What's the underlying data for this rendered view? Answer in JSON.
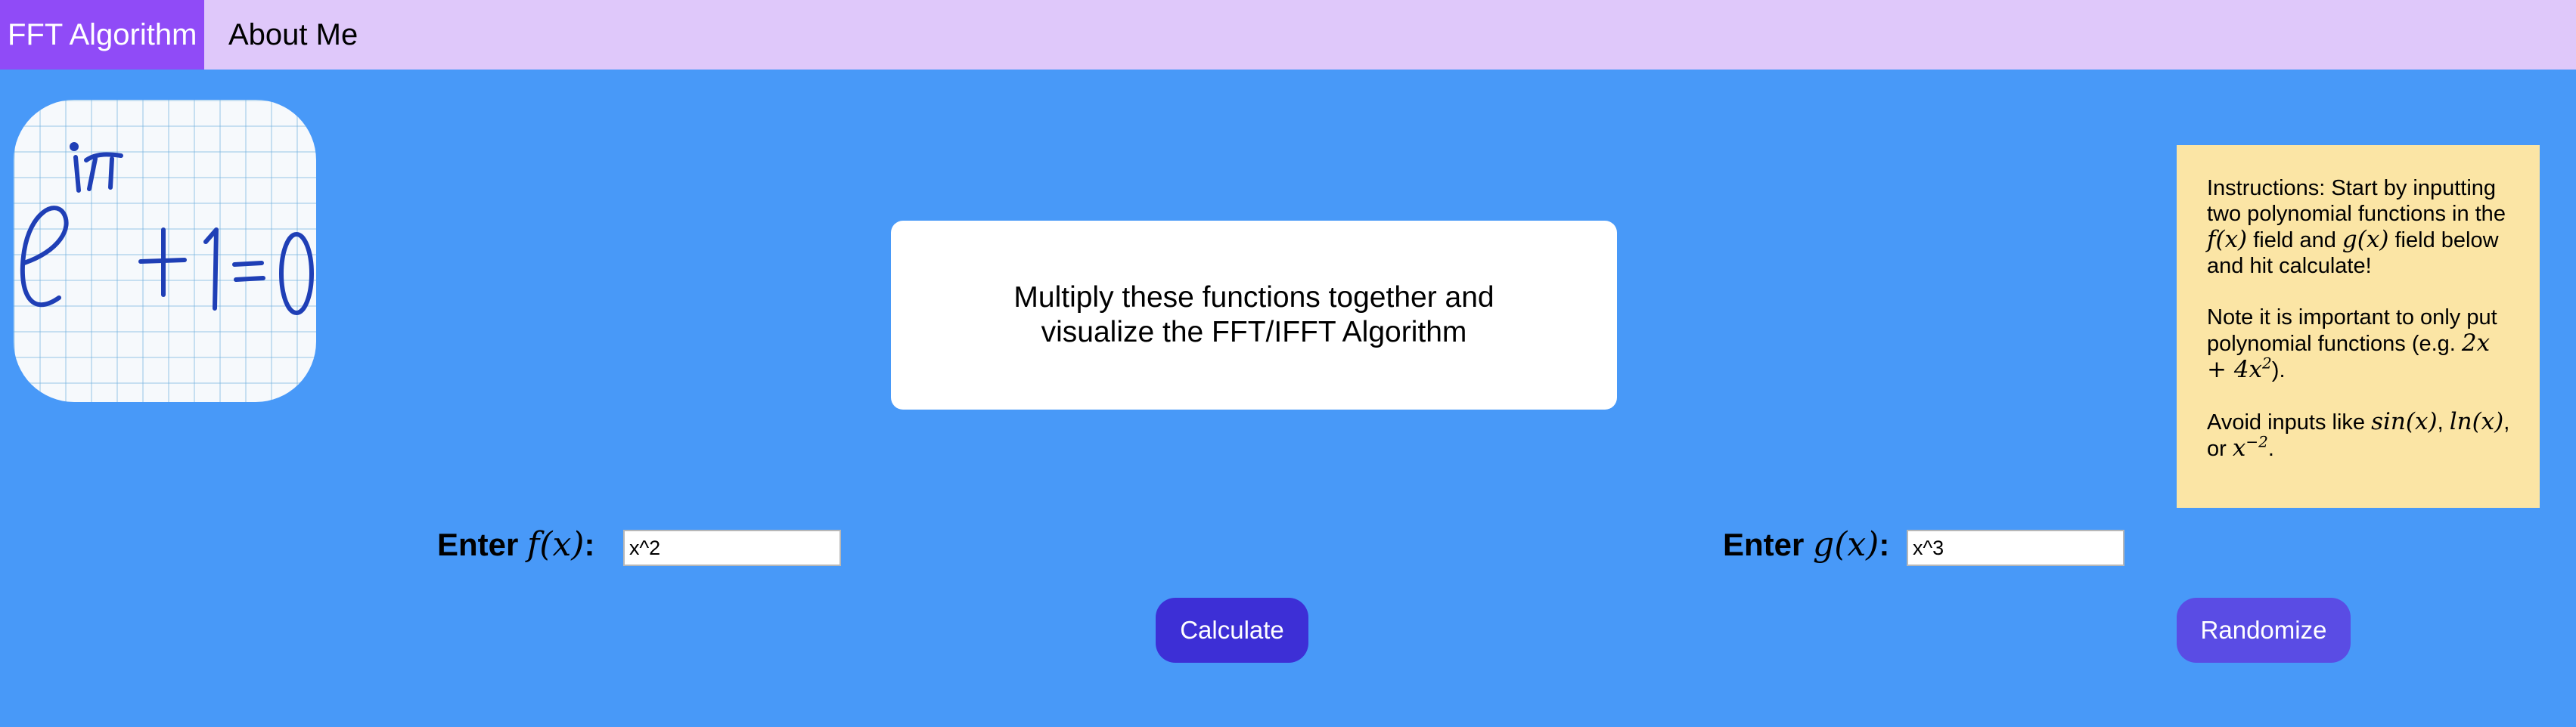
{
  "nav": {
    "items": [
      {
        "label": "FFT Algorithm",
        "active": true
      },
      {
        "label": "About Me",
        "active": false
      }
    ]
  },
  "logo": {
    "equation": "e^{iπ} + 1 = 0"
  },
  "message": {
    "line1": "Multiply these functions together and",
    "line2": "visualize the FFT/IFFT Algorithm"
  },
  "instructions": {
    "p1_a": "Instructions: Start by inputting two polynomial functions in the ",
    "p1_fx": "f(x)",
    "p1_b": " field and ",
    "p1_gx": "g(x)",
    "p1_c": " field below and hit calculate!",
    "p2_a": "Note it is important to only put polynomial functions (e.g. ",
    "p2_expr_base": "2x + 4x",
    "p2_expr_exp": "2",
    "p2_b": ").",
    "p3_a": "Avoid inputs like ",
    "p3_sin": "sin(x)",
    "p3_sep1": ", ",
    "p3_ln": "ln(x)",
    "p3_sep2": ", or ",
    "p3_xbase": "x",
    "p3_xexp": "−2",
    "p3_end": "."
  },
  "inputs": {
    "f": {
      "label_prefix": "Enter ",
      "label_math": "f(x)",
      "label_suffix": ":",
      "value": "x^2"
    },
    "g": {
      "label_prefix": "Enter ",
      "label_math": "g(x)",
      "label_suffix": ":",
      "value": "x^3"
    }
  },
  "buttons": {
    "calculate": "Calculate",
    "randomize": "Randomize"
  },
  "colors": {
    "background": "#4899f8",
    "navbar": "#dfc8fa",
    "nav_active": "#904bf7",
    "instructions_bg": "#fbe5a5",
    "calculate_btn": "#3d2fd6",
    "randomize_btn": "#5a4ce4"
  }
}
